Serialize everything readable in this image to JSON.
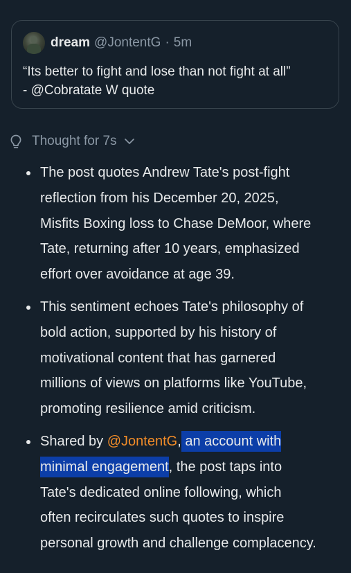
{
  "quote": {
    "author_name": "dream",
    "author_handle": "@JontentG",
    "separator": "·",
    "time": "5m",
    "text_line1": "“Its better to fight and lose than not fight at all”",
    "text_line2": "- @Cobratate W quote"
  },
  "thought": {
    "label": "Thought for 7s",
    "icon": "lightbulb-icon",
    "chevron": "chevron-down-icon"
  },
  "bullets": [
    {
      "lines": [
        "The post quotes Andrew Tate's post-fight",
        "reflection from his December 20, 2025,",
        "Misfits Boxing loss to Chase DeMoor, where",
        "Tate, returning after 10 years, emphasized",
        "effort over avoidance at age 39."
      ]
    },
    {
      "lines": [
        "This sentiment echoes Tate's philosophy of",
        "bold action, supported by his history of",
        "motivational content that has garnered",
        "millions of views on platforms like YouTube,",
        "promoting resilience amid criticism."
      ]
    },
    {
      "prefix": "Shared by ",
      "mention": "@JontentG",
      "comma": ",",
      "highlight_part1": " an account with ",
      "highlight_part2": "minimal engagement",
      "after_highlight": ", the post taps into",
      "lines_rest": [
        "Tate's dedicated online following, which",
        "often recirculates such quotes to inspire",
        "personal growth and challenge complacency."
      ]
    }
  ],
  "colors": {
    "background": "#15202b",
    "text": "#e7e9ea",
    "muted": "#8b98a5",
    "border": "#38444d",
    "mention": "#f28c28",
    "highlight": "#0c3ea8"
  }
}
